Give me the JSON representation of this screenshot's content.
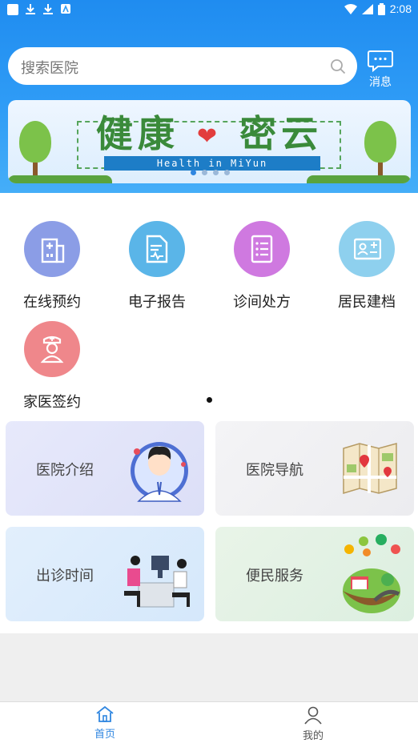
{
  "status_bar": {
    "time": "2:08"
  },
  "search": {
    "placeholder": "搜索医院"
  },
  "header": {
    "message_label": "消息"
  },
  "banner": {
    "title_left": "健康",
    "title_right": "密云",
    "ribbon_text": "Health in MiYun",
    "page_count": 4,
    "active_page": 1
  },
  "quick_actions": [
    {
      "label": "在线预约",
      "icon": "hospital-icon",
      "color": "#8b9de6"
    },
    {
      "label": "电子报告",
      "icon": "report-icon",
      "color": "#5ab5e8"
    },
    {
      "label": "诊间处方",
      "icon": "prescription-icon",
      "color": "#cf79e0"
    },
    {
      "label": "居民建档",
      "icon": "id-card-icon",
      "color": "#8ed0ee"
    },
    {
      "label": "家医签约",
      "icon": "nurse-icon",
      "color": "#ef878b"
    }
  ],
  "cards": [
    {
      "label": "医院介绍",
      "icon": "doctor-avatar-icon"
    },
    {
      "label": "医院导航",
      "icon": "map-icon"
    },
    {
      "label": "出诊时间",
      "icon": "consultation-icon"
    },
    {
      "label": "便民服务",
      "icon": "service-island-icon"
    }
  ],
  "tab_bar": {
    "home_label": "首页",
    "mine_label": "我的",
    "active_color": "#2f86e0",
    "inactive_color": "#555555"
  }
}
